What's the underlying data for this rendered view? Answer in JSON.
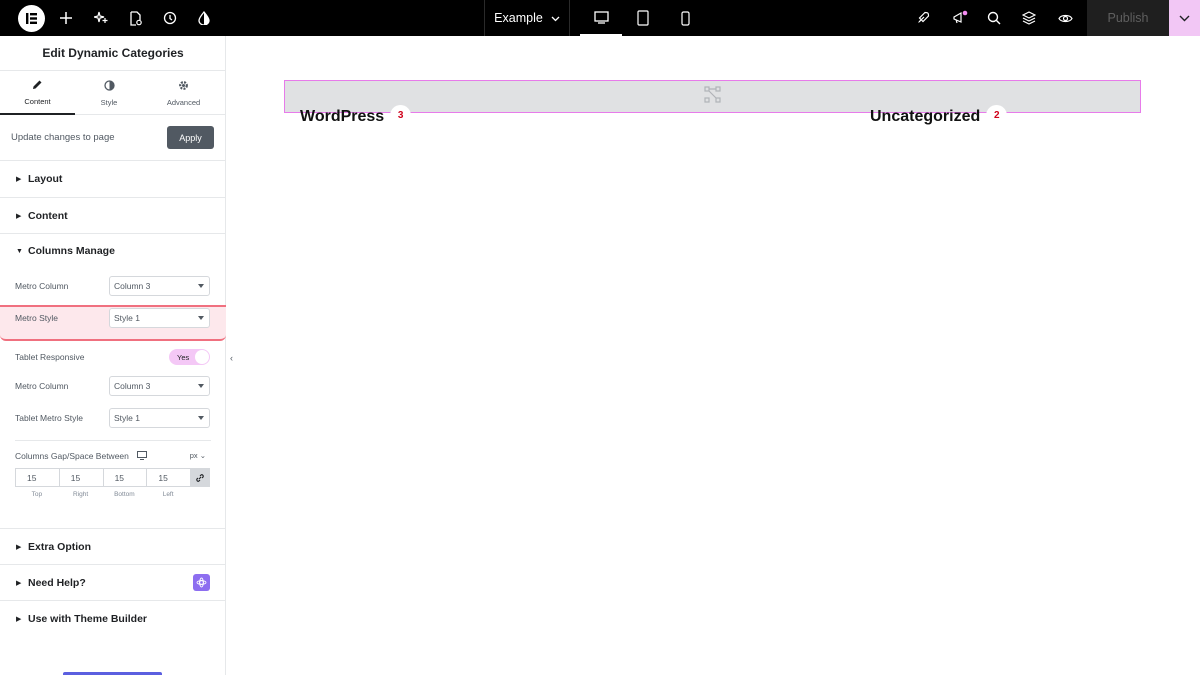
{
  "topbar": {
    "site_name": "Example",
    "publish_label": "Publish",
    "colors": {
      "background": "#000000",
      "publish_accent": "#f2c7f5"
    },
    "icons": [
      "elementor-logo-icon",
      "plus-icon",
      "sparkle-ai-icon",
      "page-settings-icon",
      "history-icon",
      "theme-style-icon",
      "chevron-down-icon",
      "desktop-icon",
      "tablet-icon",
      "mobile-icon",
      "rocket-icon",
      "announcements-icon",
      "search-icon",
      "layers-icon",
      "eye-icon"
    ]
  },
  "panel": {
    "title": "Edit Dynamic Categories",
    "tabs": [
      {
        "label": "Content",
        "icon": "pencil-icon",
        "active": true
      },
      {
        "label": "Style",
        "icon": "half-circle-icon",
        "active": false
      },
      {
        "label": "Advanced",
        "icon": "gear-icon",
        "active": false
      }
    ],
    "update_text": "Update changes to page",
    "apply_label": "Apply",
    "sections": {
      "layout": "Layout",
      "content": "Content",
      "columns_manage": "Columns Manage",
      "extra_option": "Extra Option",
      "need_help": "Need Help?",
      "theme_builder": "Use with Theme Builder"
    },
    "controls": {
      "metro_column": {
        "label": "Metro Column",
        "value": "Column 3"
      },
      "metro_style": {
        "label": "Metro Style",
        "value": "Style 1"
      },
      "tablet_responsive": {
        "label": "Tablet Responsive",
        "value": "Yes"
      },
      "tablet_metro_column": {
        "label": "Metro Column",
        "value": "Column 3"
      },
      "tablet_metro_style": {
        "label": "Tablet Metro Style",
        "value": "Style 1"
      },
      "gap": {
        "label": "Columns Gap/Space Between",
        "unit": "px",
        "top": "15",
        "right": "15",
        "bottom": "15",
        "left": "15",
        "top_label": "Top",
        "right_label": "Right",
        "bottom_label": "Bottom",
        "left_label": "Left"
      }
    }
  },
  "canvas": {
    "categories": [
      {
        "name": "WordPress",
        "count": "3"
      },
      {
        "name": "Uncategorized",
        "count": "2"
      }
    ]
  }
}
